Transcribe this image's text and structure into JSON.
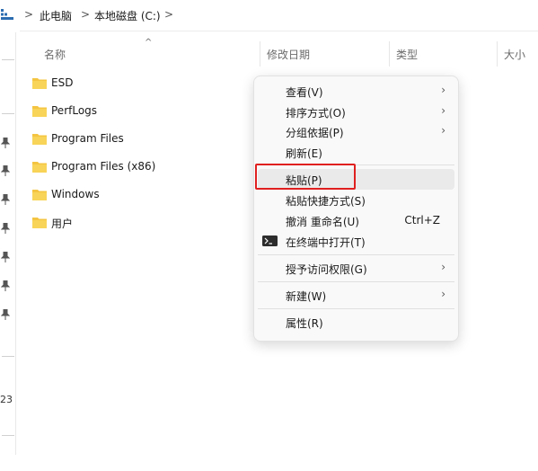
{
  "breadcrumb": {
    "sep": ">",
    "this_pc": "此电脑",
    "drive": "本地磁盘 (C:)"
  },
  "columns": {
    "name": "名称",
    "modified": "修改日期",
    "type": "类型",
    "size": "大小",
    "sort_indicator": "^"
  },
  "files": [
    {
      "name": "ESD"
    },
    {
      "name": "PerfLogs"
    },
    {
      "name": "Program Files"
    },
    {
      "name": "Program Files (x86)"
    },
    {
      "name": "Windows"
    },
    {
      "name": "用户"
    }
  ],
  "nav": {
    "partial_label": "23"
  },
  "context_menu": {
    "items": [
      {
        "label": "查看(V)",
        "arrow": "›"
      },
      {
        "label": "排序方式(O)",
        "arrow": "›"
      },
      {
        "label": "分组依据(P)",
        "arrow": "›"
      },
      {
        "label": "刷新(E)"
      },
      {
        "label": "粘贴(P)"
      },
      {
        "label": "粘贴快捷方式(S)"
      },
      {
        "label": "撤消 重命名(U)",
        "shortcut": "Ctrl+Z"
      },
      {
        "label": "在终端中打开(T)",
        "icon": "terminal-icon"
      },
      {
        "label": "授予访问权限(G)",
        "arrow": "›"
      },
      {
        "label": "新建(W)",
        "arrow": "›"
      },
      {
        "label": "属性(R)"
      }
    ]
  },
  "colors": {
    "folder": "#f4c542",
    "highlight": "#e02020",
    "menu_bg": "#f9f9f9"
  }
}
